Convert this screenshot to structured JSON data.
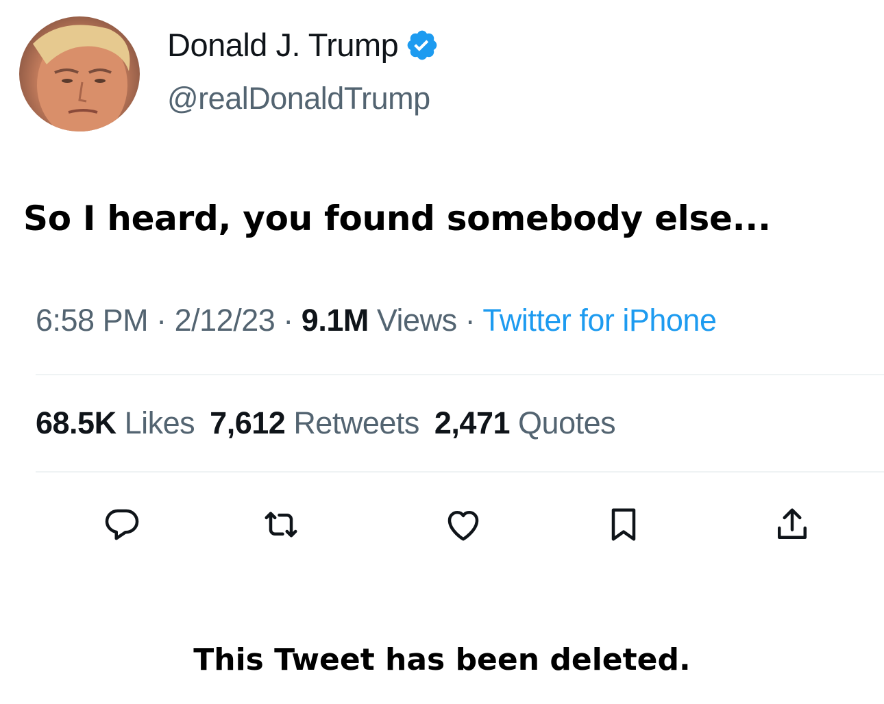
{
  "author": {
    "display_name": "Donald J. Trump",
    "handle": "@realDonaldTrump",
    "avatar_icon": "profile-photo",
    "verified_icon": "verified-badge-icon",
    "verified_color": "#1d9bf0"
  },
  "tweet": {
    "text": "So I heard, you found somebody else..."
  },
  "meta": {
    "time": "6:58 PM",
    "separator": "·",
    "date": "2/12/23",
    "views_count": "9.1M",
    "views_label": "Views",
    "source": "Twitter for iPhone",
    "source_color": "#1d9bf0"
  },
  "stats": {
    "likes_count": "68.5K",
    "likes_label": "Likes",
    "retweets_count": "7,612",
    "retweets_label": "Retweets",
    "quotes_count": "2,471",
    "quotes_label": "Quotes"
  },
  "actions": [
    {
      "name": "reply",
      "icon": "speech-bubble-icon"
    },
    {
      "name": "retweet",
      "icon": "retweet-arrows-icon"
    },
    {
      "name": "like",
      "icon": "heart-icon"
    },
    {
      "name": "bookmark",
      "icon": "bookmark-icon"
    },
    {
      "name": "share",
      "icon": "share-upload-icon"
    }
  ],
  "caption": {
    "text": "This Tweet has been deleted."
  }
}
